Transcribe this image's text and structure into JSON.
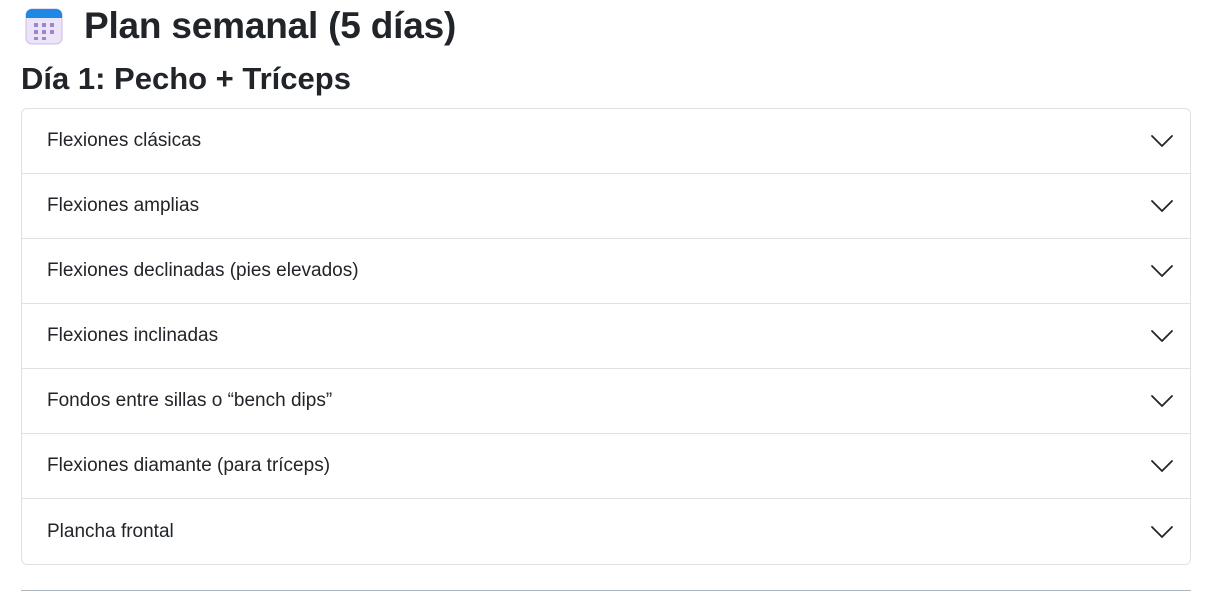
{
  "header": {
    "icon": "calendar-icon",
    "title": "Plan semanal (5 días)"
  },
  "day": {
    "title": "Día 1: Pecho + Tríceps"
  },
  "accordion": {
    "items": [
      {
        "label": "Flexiones clásicas",
        "icon": "chevron-down-icon"
      },
      {
        "label": "Flexiones amplias",
        "icon": "chevron-down-icon"
      },
      {
        "label": "Flexiones declinadas (pies elevados)",
        "icon": "chevron-down-icon"
      },
      {
        "label": "Flexiones inclinadas",
        "icon": "chevron-down-icon"
      },
      {
        "label": "Fondos entre sillas o “bench dips”",
        "icon": "chevron-down-icon"
      },
      {
        "label": "Flexiones diamante (para tríceps)",
        "icon": "chevron-down-icon"
      },
      {
        "label": "Plancha frontal",
        "icon": "chevron-down-icon"
      }
    ]
  },
  "colors": {
    "text": "#212529",
    "border": "#dee2e6",
    "calendar_header": "#1e88e5",
    "calendar_body": "#e3d7f5",
    "calendar_dots": "#9b86c9"
  }
}
